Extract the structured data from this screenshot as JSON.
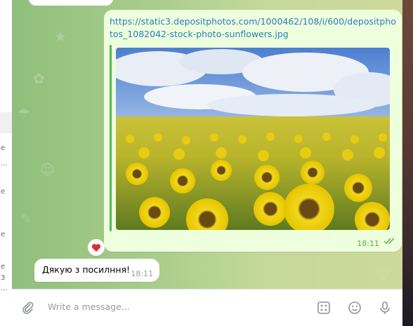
{
  "message_out": {
    "link": "https://static3.depositphotos.com/1000462/108/i/600/depositphotos_1082042-stock-photo-sunflowers.jpg",
    "time": "18:11",
    "reaction": "❤️"
  },
  "message_in": {
    "text": "Дякую з посилння!",
    "time": "18:11"
  },
  "composer": {
    "placeholder": "Write a message..."
  },
  "left_list_fragments": [
    "e",
    "...",
    "e",
    "e",
    "e",
    "3",
    "..."
  ],
  "colors": {
    "accent": "#59b75c",
    "link": "#2a7dbd",
    "outgoing_bubble": "#eeffde"
  }
}
